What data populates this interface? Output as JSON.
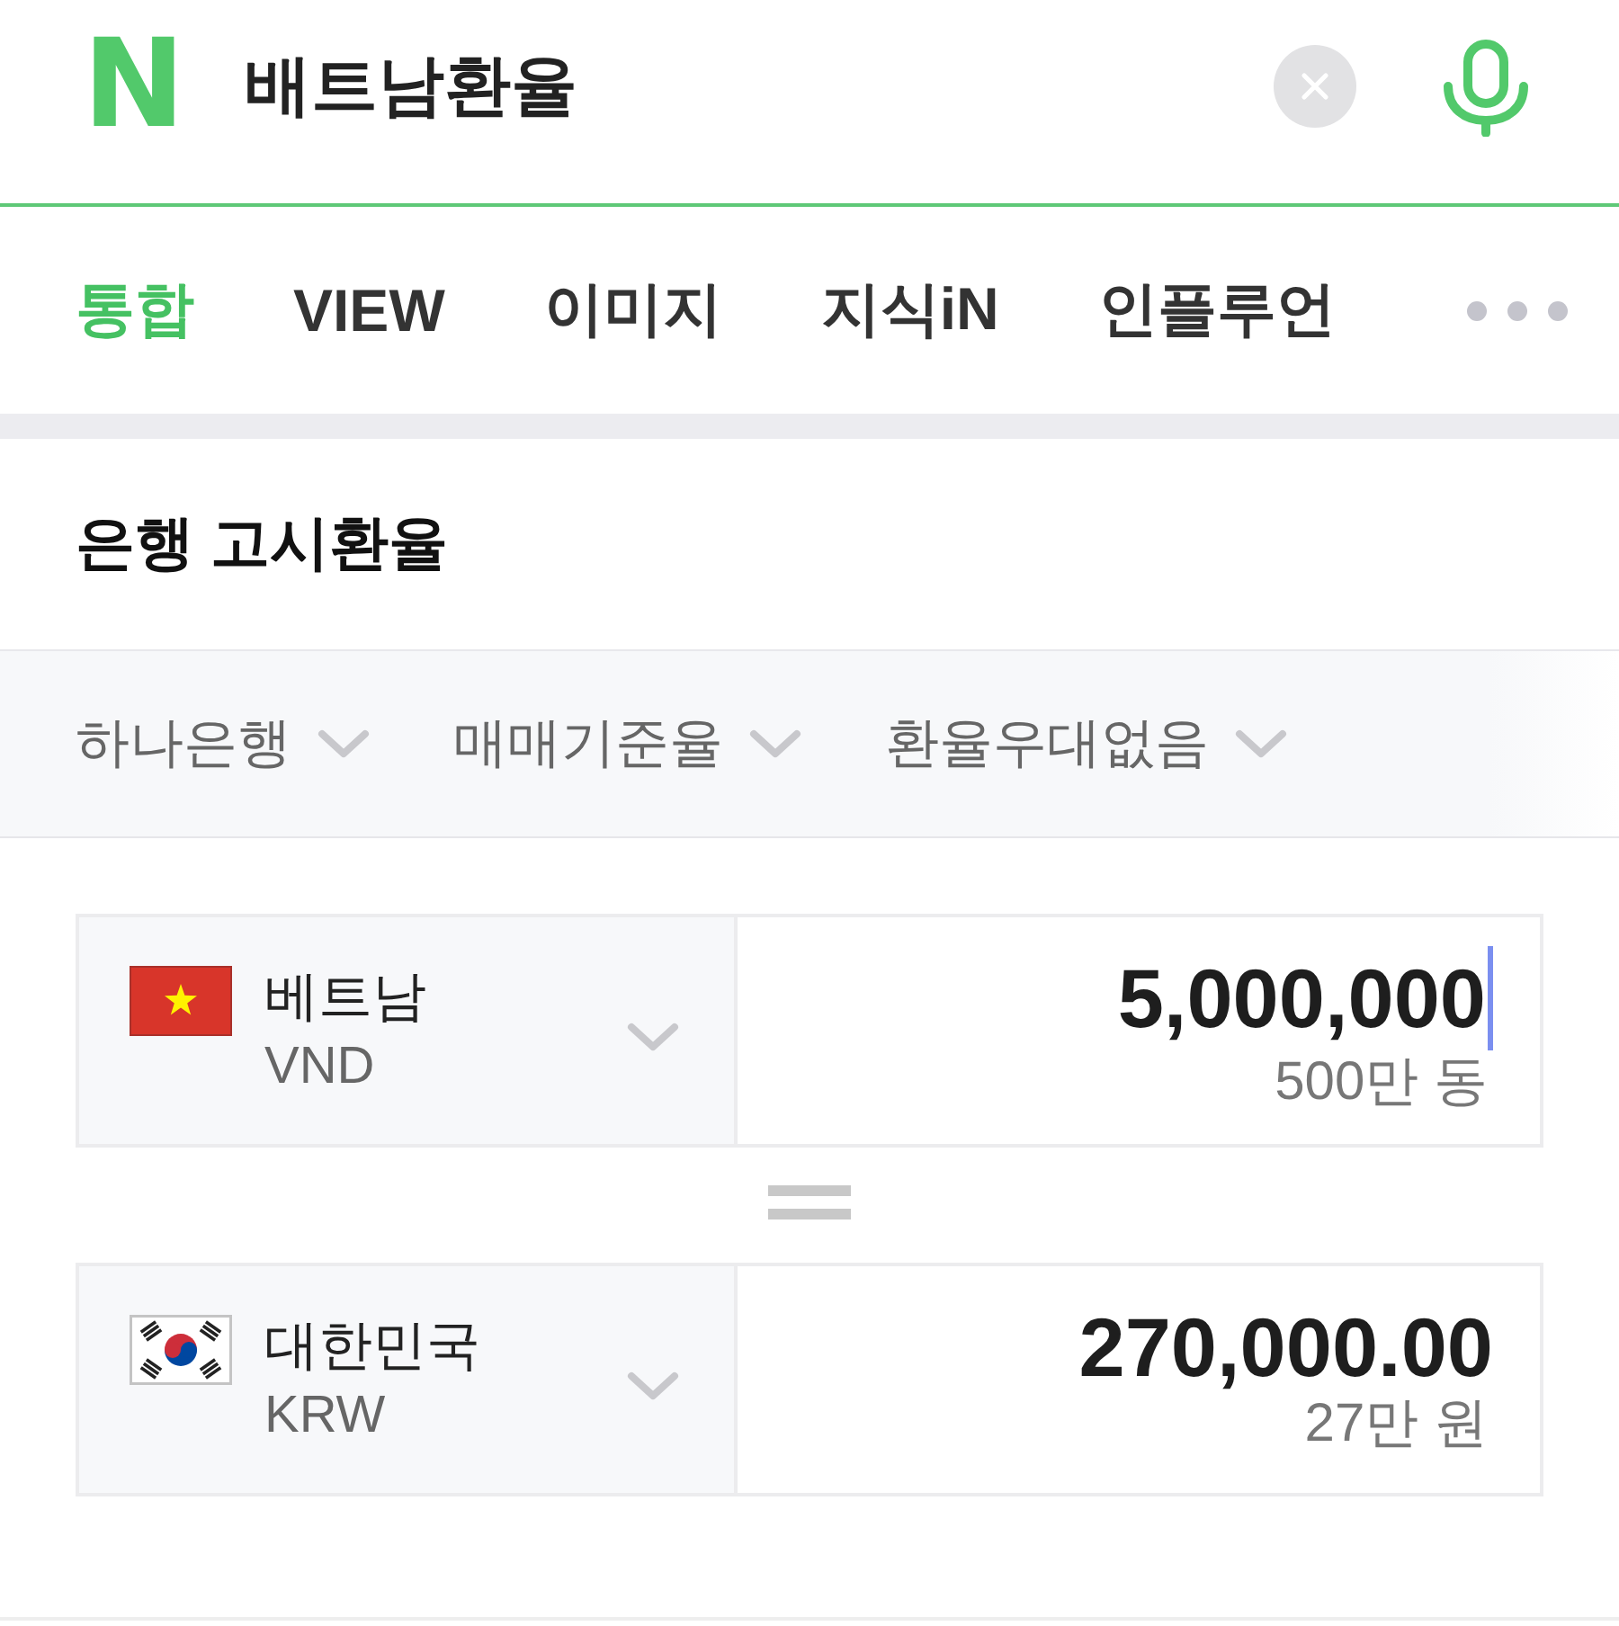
{
  "search": {
    "logo": "N",
    "query": "배트남환율"
  },
  "tabs": [
    {
      "label": "통합",
      "selected": true
    },
    {
      "label": "VIEW",
      "selected": false
    },
    {
      "label": "이미지",
      "selected": false
    },
    {
      "label": "지식iN",
      "selected": false
    },
    {
      "label": "인플루언",
      "selected": false
    }
  ],
  "section": {
    "title": "은행 고시환율"
  },
  "filters": [
    {
      "label": "하나은행"
    },
    {
      "label": "매매기준율"
    },
    {
      "label": "환율우대없음"
    }
  ],
  "converters": [
    {
      "kind": "vietnam",
      "country": "베트남",
      "code": "VND",
      "amount": "5,000,000",
      "amount_words": "500만 동",
      "focused": true
    },
    {
      "kind": "korea",
      "country": "대한민국",
      "code": "KRW",
      "amount": "270,000.00",
      "amount_words": "27만 원",
      "focused": false
    }
  ]
}
